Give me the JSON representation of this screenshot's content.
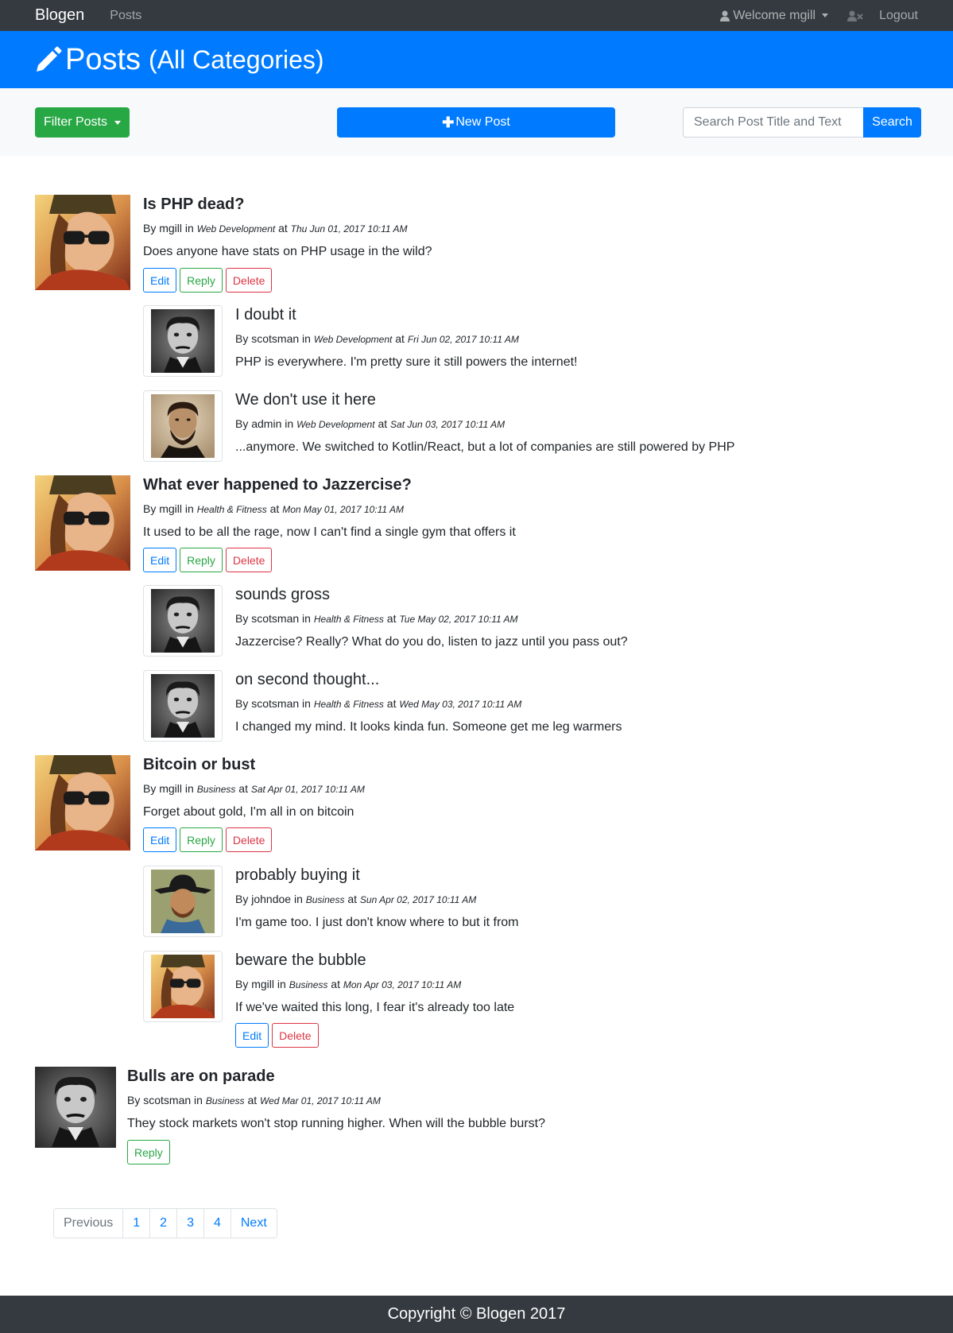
{
  "navbar": {
    "brand": "Blogen",
    "posts_link": "Posts",
    "welcome": "Welcome mgill",
    "logout": "Logout"
  },
  "header": {
    "title": "Posts",
    "subtitle": "(All Categories)"
  },
  "toolbar": {
    "filter_label": "Filter Posts",
    "new_post_label": "New Post",
    "search_placeholder": "Search Post Title and Text",
    "search_label": "Search"
  },
  "labels": {
    "by": "By",
    "in": "in",
    "at": "at",
    "edit": "Edit",
    "reply": "Reply",
    "delete": "Delete"
  },
  "posts": [
    {
      "title": "Is PHP dead?",
      "author": "mgill",
      "category": "Web Development",
      "date": "Thu Jun 01, 2017 10:11 AM",
      "body": "Does anyone have stats on PHP usage in the wild?",
      "avatar": "woman-sunglasses-avatar",
      "replies": [
        {
          "title": "I doubt it",
          "author": "scotsman",
          "category": "Web Development",
          "date": "Fri Jun 02, 2017 10:11 AM",
          "body": "PHP is everywhere. I'm pretty sure it still powers the internet!",
          "avatar": "poe-portrait-avatar"
        },
        {
          "title": "We don't use it here",
          "author": "admin",
          "category": "Web Development",
          "date": "Sat Jun 03, 2017 10:11 AM",
          "body": "...anymore. We switched to Kotlin/React, but a lot of companies are still powered by PHP",
          "avatar": "lincoln-portrait-avatar"
        }
      ]
    },
    {
      "title": "What ever happened to Jazzercise?",
      "author": "mgill",
      "category": "Health & Fitness",
      "date": "Mon May 01, 2017 10:11 AM",
      "body": "It used to be all the rage, now I can't find a single gym that offers it",
      "avatar": "woman-sunglasses-avatar",
      "replies": [
        {
          "title": "sounds gross",
          "author": "scotsman",
          "category": "Health & Fitness",
          "date": "Tue May 02, 2017 10:11 AM",
          "body": "Jazzercise? Really? What do you do, listen to jazz until you pass out?",
          "avatar": "poe-portrait-avatar"
        },
        {
          "title": "on second thought...",
          "author": "scotsman",
          "category": "Health & Fitness",
          "date": "Wed May 03, 2017 10:11 AM",
          "body": "I changed my mind. It looks kinda fun. Someone get me leg warmers",
          "avatar": "poe-portrait-avatar"
        }
      ]
    },
    {
      "title": "Bitcoin or bust",
      "author": "mgill",
      "category": "Business",
      "date": "Sat Apr 01, 2017 10:11 AM",
      "body": "Forget about gold, I'm all in on bitcoin",
      "avatar": "woman-sunglasses-avatar",
      "replies": [
        {
          "title": "probably buying it",
          "author": "johndoe",
          "category": "Business",
          "date": "Sun Apr 02, 2017 10:11 AM",
          "body": "I'm game too. I just don't know where to but it from",
          "avatar": "cowboy-portrait-avatar"
        },
        {
          "title": "beware the bubble",
          "author": "mgill",
          "category": "Business",
          "date": "Mon Apr 03, 2017 10:11 AM",
          "body": "If we've waited this long, I fear it's already too late",
          "avatar": "woman-sunglasses-avatar"
        }
      ]
    },
    {
      "title": "Bulls are on parade",
      "author": "scotsman",
      "category": "Business",
      "date": "Wed Mar 01, 2017 10:11 AM",
      "body": "They stock markets won't stop running higher. When will the bubble burst?",
      "avatar": "poe-portrait-avatar",
      "replies": []
    }
  ],
  "pagination": {
    "previous": "Previous",
    "pages": [
      "1",
      "2",
      "3",
      "4"
    ],
    "next": "Next"
  },
  "footer": "Copyright © Blogen 2017",
  "colors": {
    "navbar": "#343a40",
    "primary": "#007bff",
    "success": "#28a745",
    "danger": "#dc3545",
    "light": "#f8f9fa"
  }
}
